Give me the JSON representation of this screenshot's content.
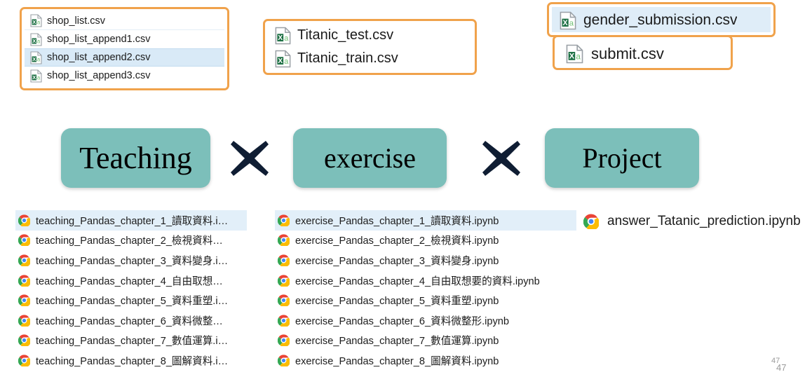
{
  "slide": {
    "page_number_small": "47",
    "page_number_large": "47"
  },
  "colors": {
    "panel_border_orange": "#F0A24B",
    "teal_box": "#7cbfba",
    "cross_navy": "#0f1d33",
    "selection_blue": "#d9eaf7"
  },
  "file_panels": {
    "shop_list": {
      "icon": "excel-csv-icon",
      "files": [
        {
          "name": "shop_list.csv",
          "selected": false
        },
        {
          "name": "shop_list_append1.csv",
          "selected": false
        },
        {
          "name": "shop_list_append2.csv",
          "selected": true
        },
        {
          "name": "shop_list_append3.csv",
          "selected": false
        }
      ]
    },
    "titanic": {
      "icon": "excel-csv-icon",
      "files": [
        {
          "name": "Titanic_test.csv",
          "selected": false
        },
        {
          "name": "Titanic_train.csv",
          "selected": false
        }
      ]
    },
    "gender_submission": {
      "icon": "excel-csv-icon",
      "files": [
        {
          "name": "gender_submission.csv",
          "selected": true
        }
      ]
    },
    "submit": {
      "icon": "excel-csv-icon",
      "files": [
        {
          "name": "submit.csv",
          "selected": false
        }
      ]
    }
  },
  "categories": [
    {
      "label": "Teaching"
    },
    {
      "label": "exercise"
    },
    {
      "label": "Project"
    }
  ],
  "operators": [
    {
      "symbol": "multiply-cross"
    },
    {
      "symbol": "multiply-cross"
    }
  ],
  "notebook_lists": {
    "teaching": {
      "icon": "chrome-icon",
      "items": [
        {
          "name": "teaching_Pandas_chapter_1_讀取資料.i…",
          "selected": true
        },
        {
          "name": "teaching_Pandas_chapter_2_檢視資料…",
          "selected": false
        },
        {
          "name": "teaching_Pandas_chapter_3_資料變身.i…",
          "selected": false
        },
        {
          "name": "teaching_Pandas_chapter_4_自由取想…",
          "selected": false
        },
        {
          "name": "teaching_Pandas_chapter_5_資料重塑.i…",
          "selected": false
        },
        {
          "name": "teaching_Pandas_chapter_6_資料微整…",
          "selected": false
        },
        {
          "name": "teaching_Pandas_chapter_7_數值運算.i…",
          "selected": false
        },
        {
          "name": "teaching_Pandas_chapter_8_圖解資料.i…",
          "selected": false
        }
      ]
    },
    "exercise": {
      "icon": "chrome-icon",
      "items": [
        {
          "name": "exercise_Pandas_chapter_1_讀取資料.ipynb",
          "selected": true
        },
        {
          "name": "exercise_Pandas_chapter_2_檢視資料.ipynb",
          "selected": false
        },
        {
          "name": "exercise_Pandas_chapter_3_資料變身.ipynb",
          "selected": false
        },
        {
          "name": "exercise_Pandas_chapter_4_自由取想要的資料.ipynb",
          "selected": false
        },
        {
          "name": "exercise_Pandas_chapter_5_資料重塑.ipynb",
          "selected": false
        },
        {
          "name": "exercise_Pandas_chapter_6_資料微整形.ipynb",
          "selected": false
        },
        {
          "name": "exercise_Pandas_chapter_7_數值運算.ipynb",
          "selected": false
        },
        {
          "name": "exercise_Pandas_chapter_8_圖解資料.ipynb",
          "selected": false
        }
      ]
    },
    "answer": {
      "icon": "chrome-icon",
      "items": [
        {
          "name": "answer_Tatanic_prediction.ipynb",
          "selected": false
        }
      ]
    }
  }
}
